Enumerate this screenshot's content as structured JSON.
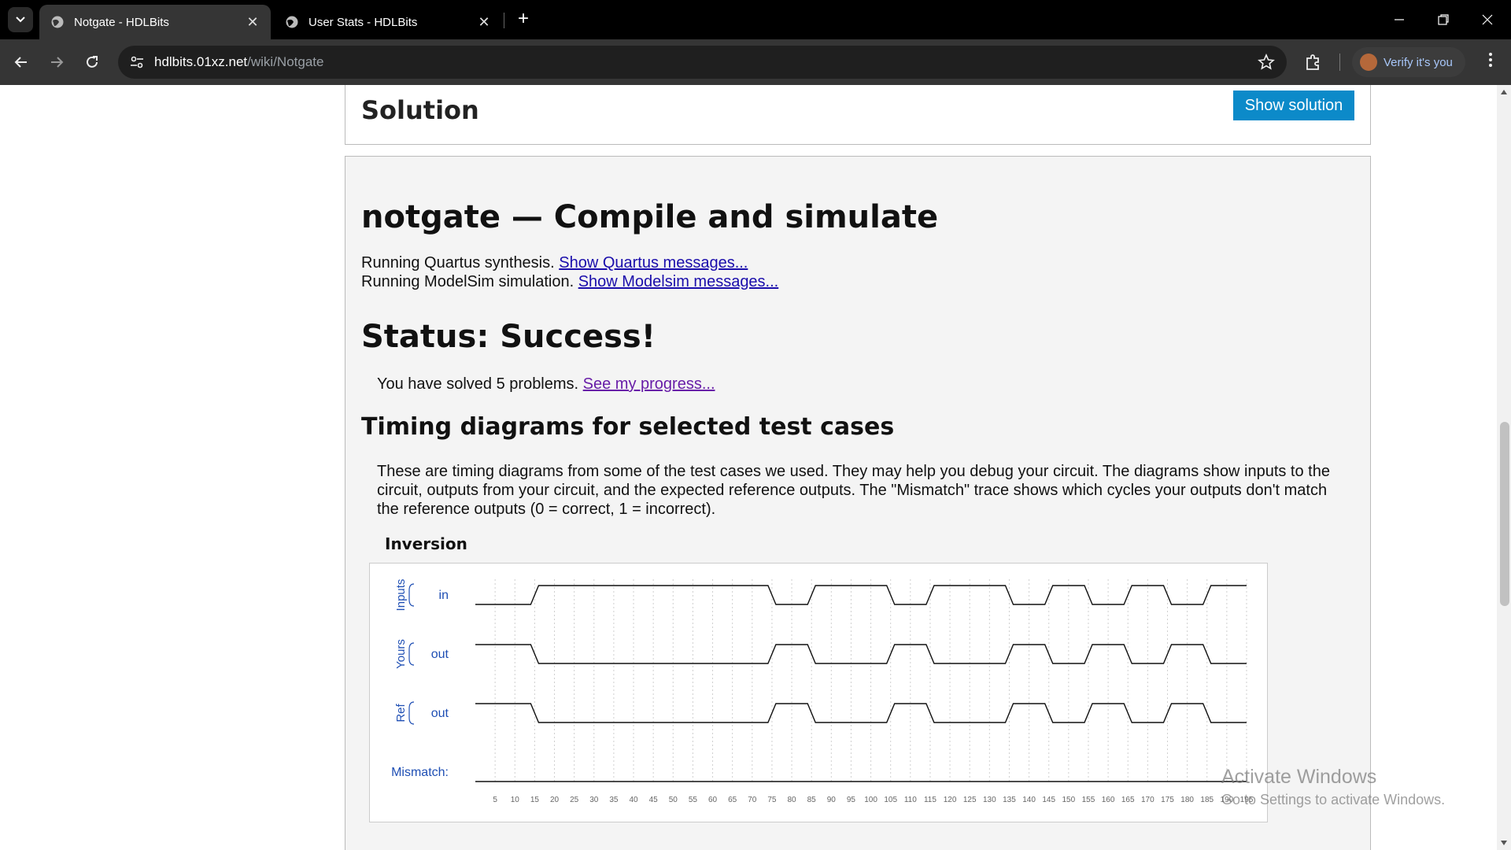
{
  "browser": {
    "tabs": [
      {
        "title": "Notgate - HDLBits",
        "active": true
      },
      {
        "title": "User Stats - HDLBits",
        "active": false
      }
    ],
    "url_host": "hdlbits.01xz.net",
    "url_path": "/wiki/Notgate",
    "verify_label": "Verify it's you"
  },
  "solution": {
    "heading": "Solution",
    "button_label": "Show solution"
  },
  "results": {
    "heading": "notgate — Compile and simulate",
    "line1_text": "Running Quartus synthesis. ",
    "line1_link": "Show Quartus messages...",
    "line2_text": "Running ModelSim simulation. ",
    "line2_link": "Show Modelsim messages...",
    "status": "Status: Success!",
    "solved_text": "You have solved 5 problems. ",
    "solved_link": "See my progress...",
    "timing_heading": "Timing diagrams for selected test cases",
    "timing_para": "These are timing diagrams from some of the test cases we used. They may help you debug your circuit. The diagrams show inputs to the circuit, outputs from your circuit, and the expected reference outputs. The \"Mismatch\" trace shows which cycles your outputs don't match the reference outputs (0 = correct, 1 = incorrect).",
    "testcase_title": "Inversion"
  },
  "chart_data": {
    "type": "timing",
    "groups": [
      {
        "group": "Inputs",
        "signal": "in"
      },
      {
        "group": "Yours",
        "signal": "out"
      },
      {
        "group": "Ref",
        "signal": "out"
      },
      {
        "group": "",
        "signal": "Mismatch:"
      }
    ],
    "ticks": [
      "5",
      "10",
      "15",
      "20",
      "25",
      "30",
      "35",
      "40",
      "45",
      "50",
      "55",
      "60",
      "65",
      "70",
      "75",
      "80",
      "85",
      "90",
      "95",
      "100",
      "105",
      "110",
      "115",
      "120",
      "125",
      "130",
      "135",
      "140",
      "145",
      "150",
      "155",
      "160",
      "165",
      "170",
      "175",
      "180",
      "185",
      "190",
      "195"
    ],
    "in_transitions": [
      {
        "t": 15,
        "v": 1
      },
      {
        "t": 75,
        "v": 0
      },
      {
        "t": 85,
        "v": 1
      },
      {
        "t": 105,
        "v": 0
      },
      {
        "t": 115,
        "v": 1
      },
      {
        "t": 135,
        "v": 0
      },
      {
        "t": 145,
        "v": 1
      },
      {
        "t": 155,
        "v": 0
      },
      {
        "t": 165,
        "v": 1
      },
      {
        "t": 175,
        "v": 0
      },
      {
        "t": 185,
        "v": 1
      }
    ],
    "in_initial": 0,
    "t_end": 195,
    "mismatch": 0
  },
  "watermark": {
    "line1": "Activate Windows",
    "line2": "Go to Settings to activate Windows."
  }
}
